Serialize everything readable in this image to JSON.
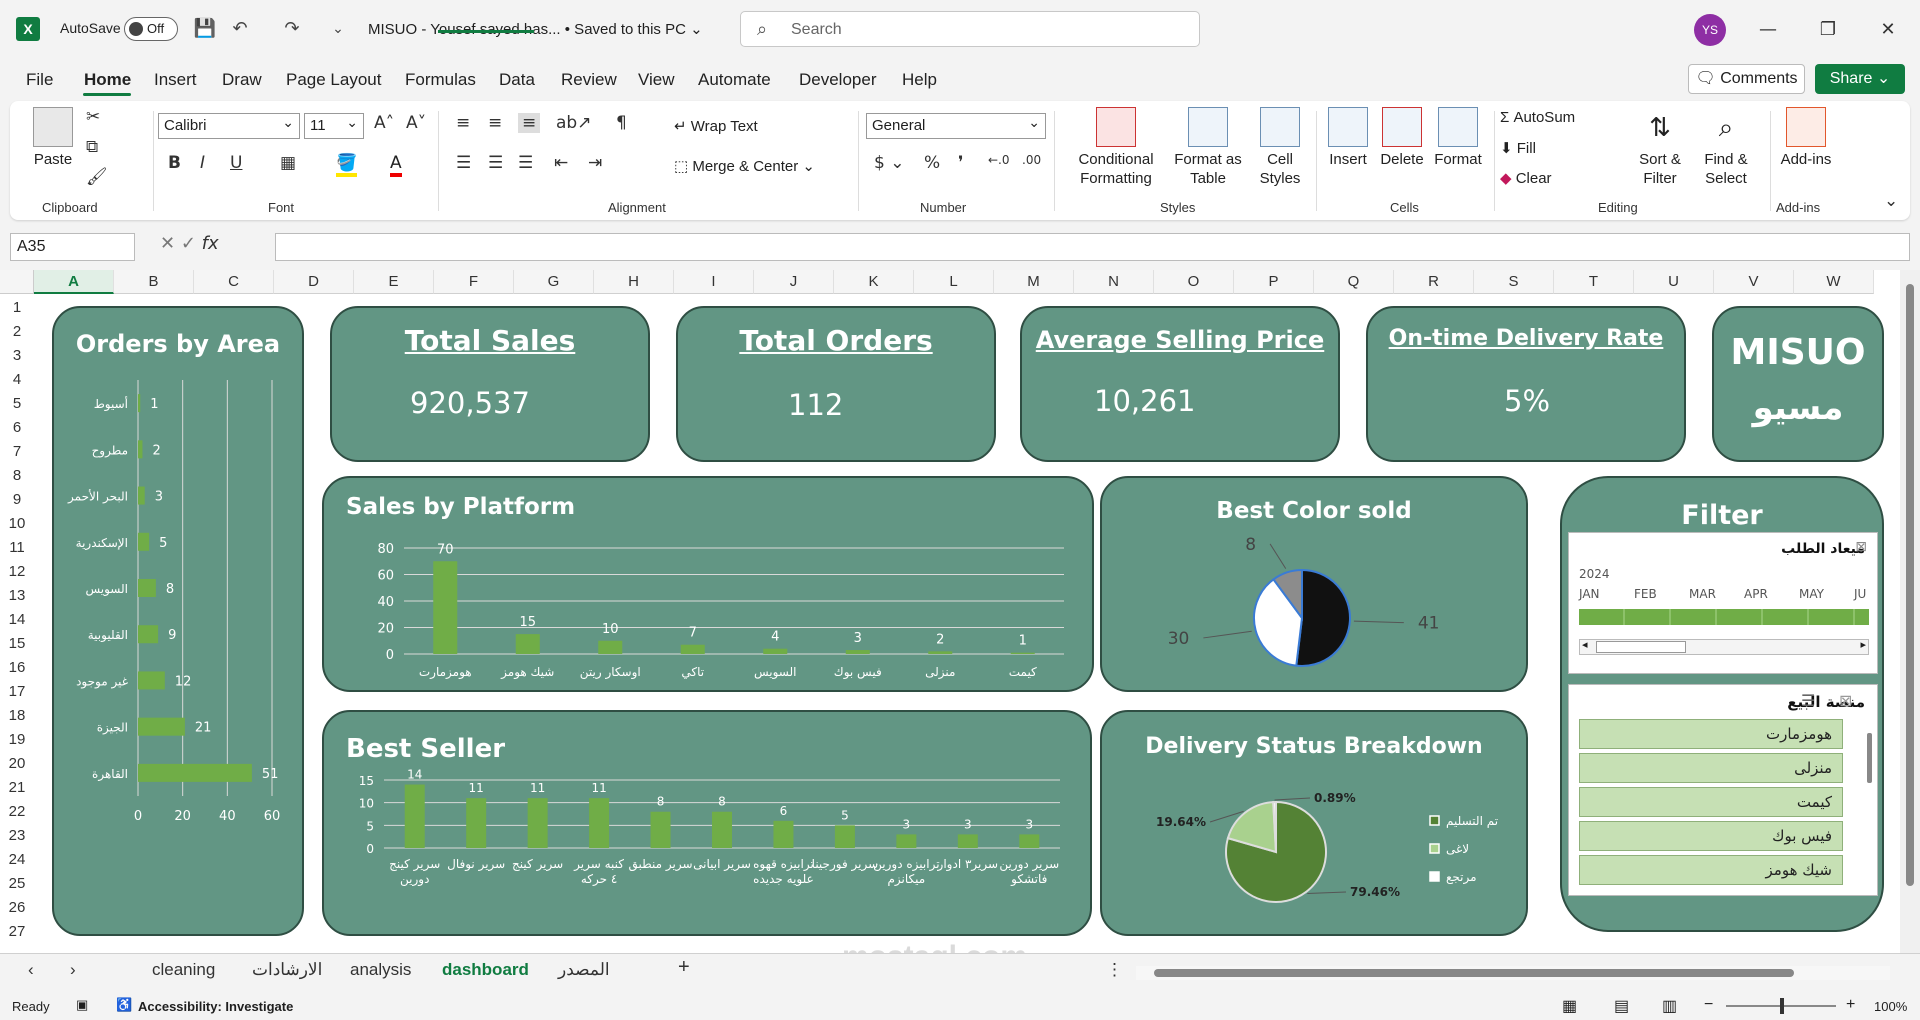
{
  "app": {
    "autosave_label": "AutoSave",
    "autosave_state": "Off",
    "doc_title": "MISUO - Yousef sayed has...  •  Saved to this PC ⌄",
    "search_placeholder": "Search",
    "user_initials": "YS"
  },
  "menu": [
    "File",
    "Home",
    "Insert",
    "Draw",
    "Page Layout",
    "Formulas",
    "Data",
    "Review",
    "View",
    "Automate",
    "Developer",
    "Help"
  ],
  "actions": {
    "comments": "Comments",
    "share": "Share"
  },
  "ribbon": {
    "clipboard": {
      "paste": "Paste",
      "label": "Clipboard"
    },
    "font": {
      "name": "Calibri",
      "size": "11",
      "label": "Font"
    },
    "alignment": {
      "wrap": "Wrap Text",
      "merge": "Merge & Center",
      "label": "Alignment"
    },
    "number": {
      "format": "General",
      "label": "Number"
    },
    "styles": {
      "conditional": "Conditional Formatting",
      "format_table": "Format as Table",
      "cell_styles": "Cell Styles",
      "label": "Styles"
    },
    "cells": {
      "insert": "Insert",
      "delete": "Delete",
      "format": "Format",
      "label": "Cells"
    },
    "editing": {
      "autosum": "AutoSum",
      "fill": "Fill",
      "clear": "Clear",
      "sort": "Sort & Filter",
      "find": "Find & Select",
      "label": "Editing"
    },
    "addins": {
      "addins": "Add-ins",
      "label": "Add-ins"
    }
  },
  "formula_bar": {
    "name_box": "A35",
    "fx": "fx"
  },
  "columns": [
    "A",
    "B",
    "C",
    "D",
    "E",
    "F",
    "G",
    "H",
    "I",
    "J",
    "K",
    "L",
    "M",
    "N",
    "O",
    "P",
    "Q",
    "R",
    "S",
    "T",
    "U",
    "V",
    "W"
  ],
  "rows": [
    "1",
    "2",
    "3",
    "4",
    "5",
    "6",
    "7",
    "8",
    "9",
    "10",
    "11",
    "12",
    "13",
    "14",
    "15",
    "16",
    "17",
    "18",
    "19",
    "20",
    "21",
    "22",
    "23",
    "24",
    "25",
    "26",
    "27"
  ],
  "kpis": {
    "total_sales": {
      "title": "Total Sales",
      "value": "920,537"
    },
    "total_orders": {
      "title": "Total Orders",
      "value": "112"
    },
    "avg_price": {
      "title": "Average Selling Price",
      "value": "10,261"
    },
    "on_time": {
      "title": "On-time Delivery Rate",
      "value": "5%"
    },
    "brand": {
      "title": "MISUO",
      "subtitle": "مسيو"
    }
  },
  "chart_titles": {
    "area": "Orders by Area",
    "platform": "Sales by Platform",
    "color": "Best Color sold",
    "seller": "Best Seller",
    "delivery": "Delivery Status Breakdown"
  },
  "filter": {
    "title": "Filter",
    "date_slicer": {
      "title": "ميعاد الطلب",
      "year": "2024",
      "months": [
        "JAN",
        "FEB",
        "MAR",
        "APR",
        "MAY",
        "JU"
      ]
    },
    "platform_slicer": {
      "title": "منصة البيع",
      "items": [
        "هومزمارت",
        "منزلى",
        "كيمت",
        "فيس بوك",
        "شيك هومز"
      ]
    }
  },
  "chart_data": [
    {
      "type": "bar",
      "title": "Orders by Area",
      "orientation": "horizontal",
      "categories": [
        "أسيوط",
        "مطروح",
        "البحر الأحمر",
        "الإسكندرية",
        "السويس",
        "القليوبية",
        "غير موجود",
        "الجيزة",
        "القاهرة"
      ],
      "values": [
        1,
        2,
        3,
        5,
        8,
        9,
        12,
        21,
        51
      ],
      "xlim": [
        0,
        60
      ],
      "xticks": [
        0,
        20,
        40,
        60
      ],
      "color": "#70ad47"
    },
    {
      "type": "bar",
      "title": "Sales by Platform",
      "categories": [
        "هومزمارت",
        "شيك هومز",
        "اوسكار ريتن",
        "تاكي",
        "السويس",
        "فيس بوك",
        "منزلى",
        "كيمت"
      ],
      "values": [
        70,
        15,
        10,
        7,
        4,
        3,
        2,
        1
      ],
      "ylim": [
        0,
        80
      ],
      "yticks": [
        0,
        20,
        40,
        60,
        80
      ],
      "color": "#70ad47"
    },
    {
      "type": "pie",
      "title": "Best Color sold",
      "values": [
        41,
        30,
        8
      ],
      "labels": [
        "41",
        "30",
        "8"
      ],
      "colors": [
        "#111111",
        "#ffffff",
        "#8c8c8c"
      ]
    },
    {
      "type": "bar",
      "title": "Best Seller",
      "categories": [
        "سرير كينج دورين",
        "سرير نوفال",
        "سرير كينج",
        "كنبه سرير ٤ حركه",
        "سرير منطبق",
        "سرير ابيانى",
        "ترابيزه قهوه علويه جديده",
        "سرير فورجينا",
        "ترابيزه دورين ميكانزم",
        "سرير٣ ادوار",
        "سرير دورين فاتشكو"
      ],
      "values": [
        14,
        11,
        11,
        11,
        8,
        8,
        6,
        5,
        3,
        3,
        3
      ],
      "ylim": [
        0,
        15
      ],
      "yticks": [
        0,
        5,
        10,
        15
      ],
      "color": "#70ad47"
    },
    {
      "type": "pie",
      "title": "Delivery Status Breakdown",
      "categories": [
        "تم التسليم",
        "لاغى",
        "مرتجع"
      ],
      "values": [
        79.46,
        19.64,
        0.89
      ],
      "labels": [
        "79.46%",
        "19.64%",
        "0.89%"
      ],
      "colors": [
        "#548235",
        "#a9d18e",
        "#ffffff"
      ],
      "legend": "right"
    }
  ],
  "sheet_tabs": [
    "cleaning",
    "الارشادات",
    "analysis",
    "dashboard",
    "المصدر"
  ],
  "status": {
    "ready": "Ready",
    "accessibility": "Accessibility: Investigate",
    "zoom": "100%"
  },
  "watermark": "mostaql.com"
}
